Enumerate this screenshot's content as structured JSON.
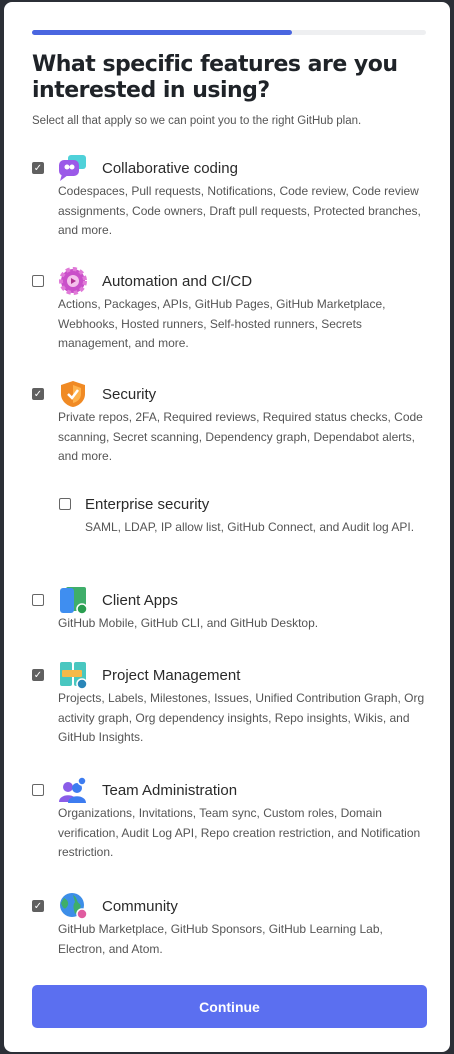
{
  "progress_percent": 66,
  "title": "What specific features are you interested in using?",
  "subtitle": "Select all that apply so we can point you to the right GitHub plan.",
  "items": [
    {
      "label": "Collaborative coding",
      "checked": true,
      "icon": "chat-bubbles-icon",
      "description": "Codespaces, Pull requests, Notifications, Code review, Code review assignments, Code owners, Draft pull requests, Protected branches, and more."
    },
    {
      "label": "Automation and CI/CD",
      "checked": false,
      "icon": "gear-icon",
      "description": "Actions, Packages, APIs, GitHub Pages, GitHub Marketplace, Webhooks, Hosted runners, Self-hosted runners, Secrets management, and more."
    },
    {
      "label": "Security",
      "checked": true,
      "icon": "shield-icon",
      "description": "Private repos, 2FA, Required reviews, Required status checks, Code scanning, Secret scanning, Dependency graph, Dependabot alerts, and more."
    },
    {
      "label": "Enterprise security",
      "checked": false,
      "icon": "",
      "description": "SAML, LDAP, IP allow list, GitHub Connect, and Audit log API."
    },
    {
      "label": "Client Apps",
      "checked": false,
      "icon": "devices-icon",
      "description": "GitHub Mobile, GitHub CLI, and GitHub Desktop."
    },
    {
      "label": "Project Management",
      "checked": true,
      "icon": "project-board-icon",
      "description": "Projects, Labels, Milestones, Issues, Unified Contribution Graph, Org activity graph, Org dependency insights, Repo insights, Wikis, and GitHub Insights."
    },
    {
      "label": "Team Administration",
      "checked": false,
      "icon": "team-icon",
      "description": "Organizations, Invitations, Team sync, Custom roles, Domain verification, Audit Log API, Repo creation restriction, and Notification restriction."
    },
    {
      "label": "Community",
      "checked": true,
      "icon": "globe-icon",
      "description": "GitHub Marketplace, GitHub Sponsors, GitHub Learning Lab, Electron, and Atom."
    }
  ],
  "continue_label": "Continue",
  "colors": {
    "accent": "#5b6ff0",
    "progress": "#4a66e0"
  }
}
